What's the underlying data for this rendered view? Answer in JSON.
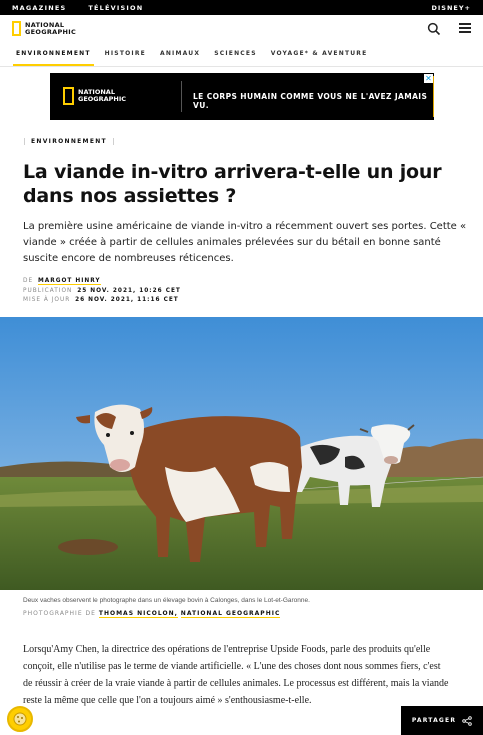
{
  "topbar": {
    "links": [
      "MAGAZINES",
      "TÉLÉVISION"
    ],
    "right": "DISNEY+"
  },
  "header": {
    "logo_line1": "NATIONAL",
    "logo_line2": "GEOGRAPHIC"
  },
  "nav": {
    "items": [
      "ENVIRONNEMENT",
      "HISTOIRE",
      "ANIMAUX",
      "SCIENCES",
      "VOYAGE* & AVENTURE"
    ]
  },
  "ad": {
    "logo_line1": "NATIONAL",
    "logo_line2": "GEOGRAPHIC",
    "headline": "LE CORPS HUMAIN COMME VOUS NE L'AVEZ JAMAIS VU.",
    "close": "✕"
  },
  "article": {
    "tag": "ENVIRONNEMENT",
    "title": "La viande in-vitro arrivera-t-elle un jour dans nos assiettes ?",
    "dek": "La première usine américaine de viande in-vitro a récemment ouvert ses portes. Cette « viande » créée à partir de cellules animales prélevées sur du bétail en bonne santé suscite encore de nombreuses réticences.",
    "byline_label": "DE",
    "author": "MARGOT HINRY",
    "published_label": "PUBLICATION",
    "published": "25 NOV. 2021, 10:26 CET",
    "updated_label": "MISE À JOUR",
    "updated": "26 NOV. 2021, 11:16 CET",
    "caption": "Deux vaches observent le photographe dans un élevage bovin à Calonges, dans le Lot-et-Garonne.",
    "credit_label": "PHOTOGRAPHIE DE",
    "credit_photographer": "THOMAS NICOLON,",
    "credit_org": "NATIONAL GEOGRAPHIC",
    "body": "Lorsqu'Amy Chen, la directrice des opérations de l'entreprise Upside Foods, parle des produits qu'elle conçoit, elle n'utilise pas le terme de viande artificielle. « L'une des choses dont nous sommes fiers, c'est de réussir à créer de la vraie viande à partir de cellules animales. Le processus est différent, mais la viande reste la même que celle que l'on a toujours aimé » s'enthousiasme-t-elle."
  },
  "share": {
    "label": "PARTAGER"
  },
  "colors": {
    "accent": "#ffce00",
    "black": "#000000"
  }
}
